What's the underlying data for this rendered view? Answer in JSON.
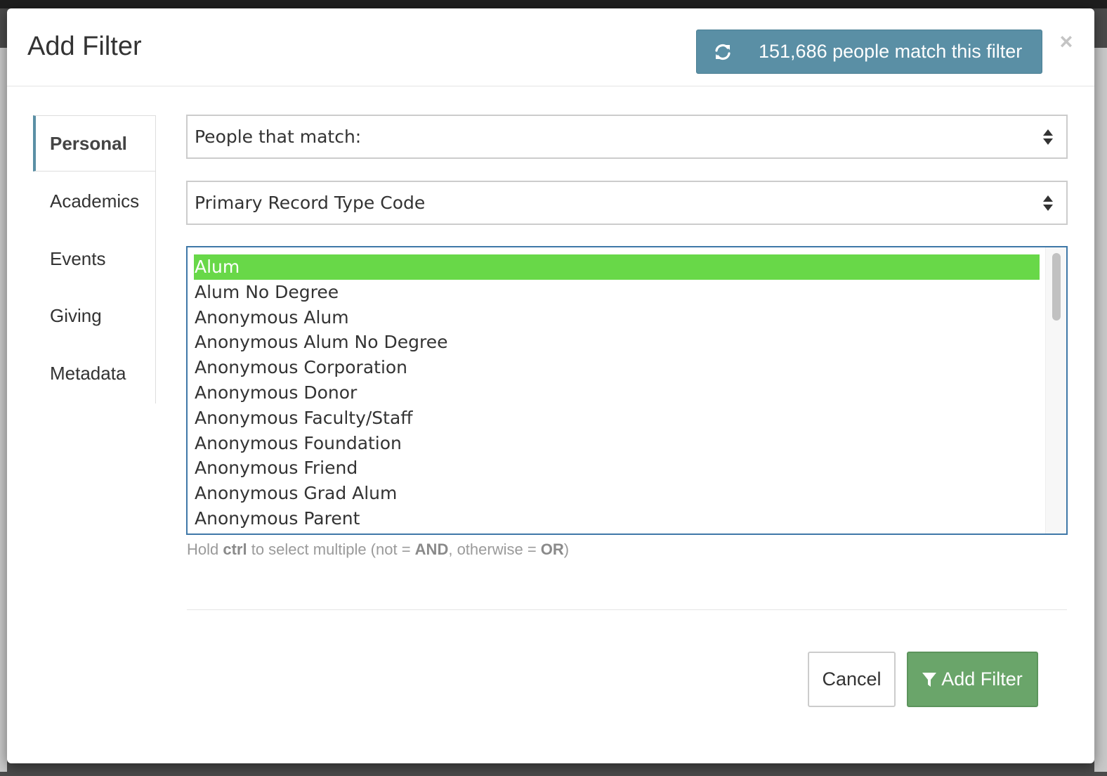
{
  "modal": {
    "title": "Add Filter",
    "match_button_label": "151,686 people match this filter",
    "match_button_icon": "refresh-icon",
    "close_label": "×"
  },
  "sidebar": {
    "items": [
      {
        "label": "Personal",
        "active": true
      },
      {
        "label": "Academics",
        "active": false
      },
      {
        "label": "Events",
        "active": false
      },
      {
        "label": "Giving",
        "active": false
      },
      {
        "label": "Metadata",
        "active": false
      }
    ]
  },
  "match_select": {
    "value": "People that match:"
  },
  "field_select": {
    "value": "Primary Record Type Code"
  },
  "options": {
    "selected": "Alum",
    "items": [
      "Alum",
      "Alum No Degree",
      "Anonymous Alum",
      "Anonymous Alum No Degree",
      "Anonymous Corporation",
      "Anonymous Donor",
      "Anonymous Faculty/Staff",
      "Anonymous Foundation",
      "Anonymous Friend",
      "Anonymous Grad Alum",
      "Anonymous Parent"
    ]
  },
  "help": {
    "hold": "Hold ",
    "ctrl": "ctrl",
    "mid": " to select multiple (not = ",
    "and": "AND",
    "otherwise": ", otherwise = ",
    "or": "OR",
    "close_paren": ")"
  },
  "footer": {
    "cancel_label": "Cancel",
    "add_label": "Add Filter",
    "add_icon": "filter-icon"
  },
  "colors": {
    "match_button": "#5a8fa5",
    "selected_option": "#68d848",
    "add_button": "#6aa56a",
    "listbox_border": "#3f78a8"
  }
}
